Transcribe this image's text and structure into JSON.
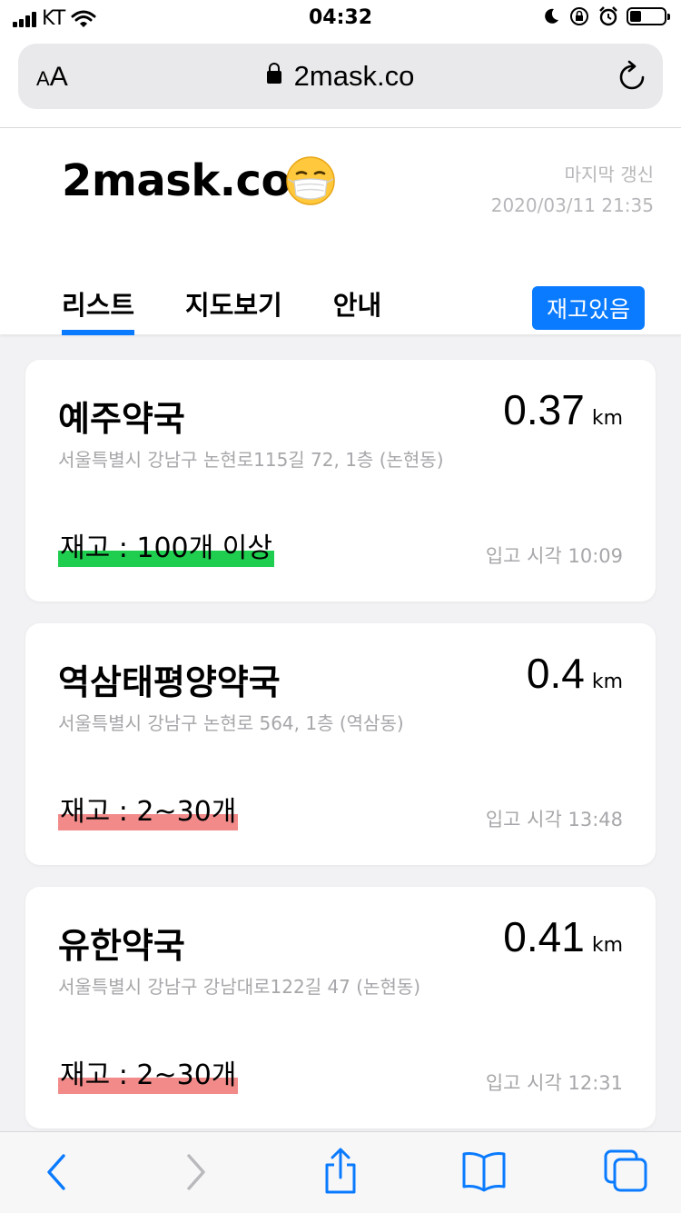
{
  "status_bar": {
    "carrier": "KT",
    "time": "04:32"
  },
  "browser": {
    "text_size_small": "A",
    "text_size_large": "A",
    "url": "2mask.co"
  },
  "site": {
    "title": "2mask.co",
    "last_updated_label": "마지막 갱신",
    "last_updated_time": "2020/03/11 21:35"
  },
  "tabs": [
    {
      "label": "리스트",
      "active": true
    },
    {
      "label": "지도보기",
      "active": false
    },
    {
      "label": "안내",
      "active": false
    }
  ],
  "stock_filter_button": "재고있음",
  "colors": {
    "accent": "#0a7bff",
    "stock_high": "#1fce4f",
    "stock_low": "#f28a8a"
  },
  "pharmacies": [
    {
      "name": "예주약국",
      "distance": "0.37",
      "unit": "km",
      "address": "서울특별시 강남구 논현로115길 72, 1층 (논현동)",
      "stock": "재고 : 100개 이상",
      "stock_level": "high",
      "arrival": "입고 시각 10:09"
    },
    {
      "name": "역삼태평양약국",
      "distance": "0.4",
      "unit": "km",
      "address": "서울특별시 강남구 논현로 564, 1층 (역삼동)",
      "stock": "재고 : 2~30개",
      "stock_level": "low",
      "arrival": "입고 시각 13:48"
    },
    {
      "name": "유한약국",
      "distance": "0.41",
      "unit": "km",
      "address": "서울특별시 강남구 강남대로122길 47 (논현동)",
      "stock": "재고 : 2~30개",
      "stock_level": "low",
      "arrival": "입고 시각 12:31"
    }
  ],
  "toolbar_icons": [
    "back-icon",
    "forward-icon",
    "share-icon",
    "bookmarks-icon",
    "tabs-icon"
  ]
}
